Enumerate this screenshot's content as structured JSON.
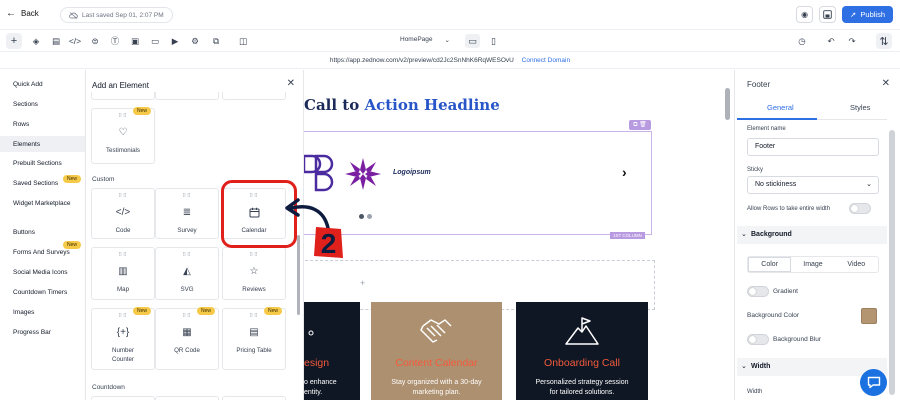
{
  "topbar": {
    "back_label": "Back",
    "saved_text": "Last saved Sep 01, 2:07 PM",
    "publish_label": "Publish"
  },
  "toolbar": {
    "tools": [
      "add-icon",
      "layers-icon",
      "pages-icon",
      "code-icon",
      "tag-icon",
      "text-icon",
      "image-icon",
      "form-icon",
      "media-icon",
      "settings-icon",
      "layout-icon"
    ],
    "page_selector": "HomePage",
    "page_selector_icon": "chevron-down-icon",
    "devices": [
      "desktop-icon",
      "mobile-icon"
    ]
  },
  "url": {
    "address": "https://app.zednow.com/v2/preview/cd2Jc2SnNhK6RqWESOvU",
    "connect_label": "Connect Domain"
  },
  "sidebar": {
    "items": [
      {
        "label": "Quick Add"
      },
      {
        "label": "Sections"
      },
      {
        "label": "Rows"
      },
      {
        "label": "Elements",
        "active": true
      },
      {
        "label": "Prebuilt Sections"
      },
      {
        "label": "Saved Sections",
        "badge": "New"
      },
      {
        "label": "Widget Marketplace"
      },
      {
        "label": "Buttons"
      },
      {
        "label": "Forms And Surveys",
        "badge": "New"
      },
      {
        "label": "Social Media Icons"
      },
      {
        "label": "Countdown Timers"
      },
      {
        "label": "Images"
      },
      {
        "label": "Progress Bar"
      }
    ]
  },
  "panel": {
    "title": "Add an Element",
    "group_custom": "Custom",
    "group_countdown": "Countdown",
    "tiles": {
      "testimonials": {
        "label": "Testimonials",
        "badge": "New"
      },
      "code": {
        "label": "Code"
      },
      "survey": {
        "label": "Survey"
      },
      "calendar": {
        "label": "Calendar"
      },
      "map": {
        "label": "Map"
      },
      "svg": {
        "label": "SVG"
      },
      "reviews": {
        "label": "Reviews"
      },
      "number_counter": {
        "label_1": "Number",
        "label_2": "Counter",
        "badge": "New"
      },
      "qr_code": {
        "label": "QR Code",
        "badge": "New"
      },
      "pricing_table": {
        "label": "Pricing Table",
        "badge": "New"
      }
    }
  },
  "annotation": {
    "number": "2",
    "color": "#e0201b"
  },
  "canvas": {
    "headline_prefix": "Call to ",
    "headline_accent": "Action Headline",
    "logo_text": "Logoipsum",
    "logo_tag": "1ST COLUMN",
    "cards": [
      {
        "title": "esign",
        "desc_1": "o enhance",
        "desc_2": "entity.",
        "bg": "#0f1724"
      },
      {
        "title": "Content Calendar",
        "desc_1": "Stay organized with a 30-day",
        "desc_2": "marketing plan.",
        "bg": "#ad906f"
      },
      {
        "title": "Onboarding Call",
        "desc_1": "Personalized strategy session",
        "desc_2": "for tailored solutions.",
        "bg": "#0f1724"
      }
    ]
  },
  "props": {
    "title": "Footer",
    "tab_general": "General",
    "tab_styles": "Styles",
    "element_name_label": "Element name",
    "element_name_value": "Footer",
    "sticky_label": "Sticky",
    "sticky_value": "No stickiness",
    "allow_rows_label": "Allow Rows to take entire width",
    "background_section": "Background",
    "bg_tabs": [
      "Color",
      "Image",
      "Video"
    ],
    "gradient_label": "Gradient",
    "bg_color_label": "Background Color",
    "bg_color": "#b49572",
    "bg_blur_label": "Background Blur",
    "width_section": "Width",
    "width_label": "Width"
  },
  "colors": {
    "accent": "#2f6fe4",
    "headline": "#1b2a5a",
    "card_title": "#f35a3c"
  }
}
